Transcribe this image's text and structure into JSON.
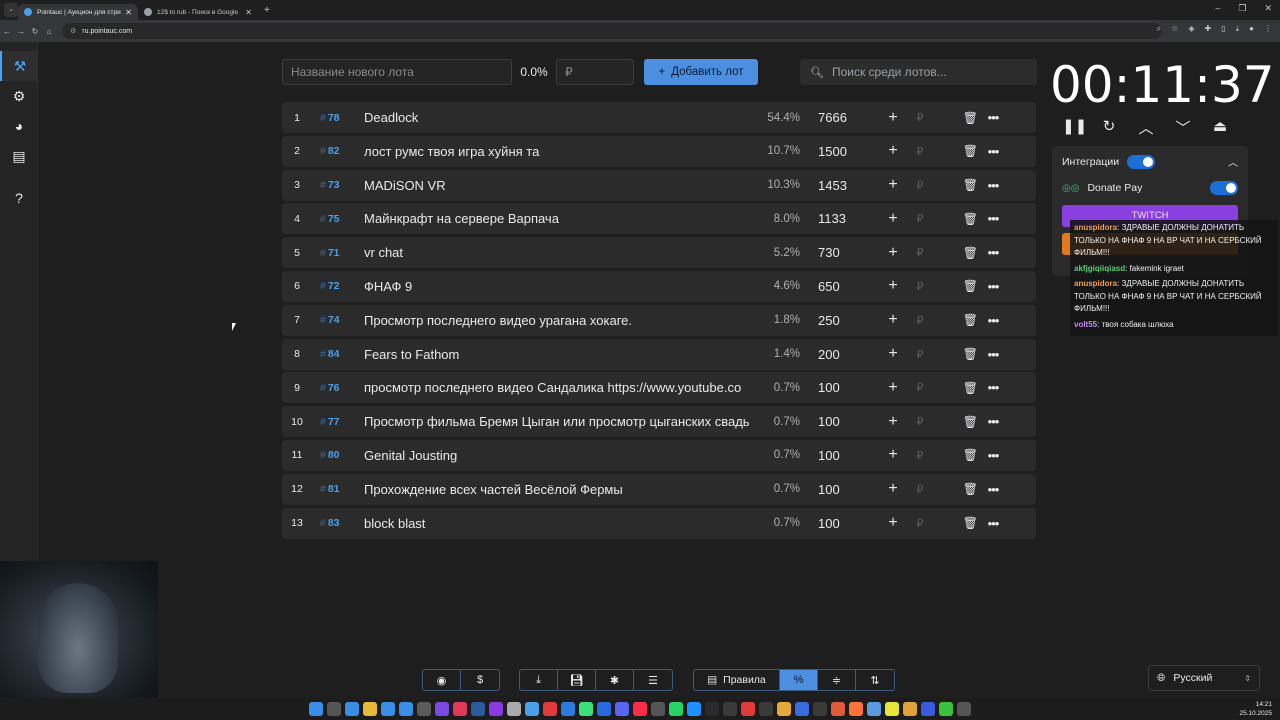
{
  "browser": {
    "tabs": [
      {
        "title": "Pointauc | Аукцион для стриме",
        "active": true,
        "favicon_color": "#4a9fe8"
      },
      {
        "title": "12$ to rub - Поиск в Google",
        "active": false,
        "favicon_color": "#9aa0a6"
      }
    ],
    "url": "ru.pointauc.com"
  },
  "form": {
    "name_placeholder": "Название нового лота",
    "percent": "0.0%",
    "amount_placeholder": "₽",
    "add_label": "Добавить лот",
    "search_placeholder": "Поиск среди лотов..."
  },
  "lots": [
    {
      "num": "1",
      "id": "78",
      "name": "Deadlock",
      "pct": "54.4%",
      "amount": "7666"
    },
    {
      "num": "2",
      "id": "82",
      "name": "лост румс твоя игра хуйня та",
      "pct": "10.7%",
      "amount": "1500"
    },
    {
      "num": "3",
      "id": "73",
      "name": "MADiSON VR",
      "pct": "10.3%",
      "amount": "1453"
    },
    {
      "num": "4",
      "id": "75",
      "name": "Майнкрафт на сервере Варпача",
      "pct": "8.0%",
      "amount": "1133"
    },
    {
      "num": "5",
      "id": "71",
      "name": "vr chat",
      "pct": "5.2%",
      "amount": "730"
    },
    {
      "num": "6",
      "id": "72",
      "name": "ФНАФ 9",
      "pct": "4.6%",
      "amount": "650"
    },
    {
      "num": "7",
      "id": "74",
      "name": "Просмотр последнего видео урагана хокаге.",
      "pct": "1.8%",
      "amount": "250"
    },
    {
      "num": "8",
      "id": "84",
      "name": "Fears to Fathom",
      "pct": "1.4%",
      "amount": "200"
    },
    {
      "num": "9",
      "id": "76",
      "name": "просмотр последнего видео Сандалика https://www.youtube.co",
      "pct": "0.7%",
      "amount": "100"
    },
    {
      "num": "10",
      "id": "77",
      "name": "Просмотр фильма Бремя Цыган или просмотр цыганских свадь",
      "pct": "0.7%",
      "amount": "100"
    },
    {
      "num": "11",
      "id": "80",
      "name": "Genital Jousting",
      "pct": "0.7%",
      "amount": "100"
    },
    {
      "num": "12",
      "id": "81",
      "name": "Прохождение всех частей Весёлой Фермы",
      "pct": "0.7%",
      "amount": "100"
    },
    {
      "num": "13",
      "id": "83",
      "name": "block blast",
      "pct": "0.7%",
      "amount": "100"
    }
  ],
  "timer": {
    "value": "00:11:37"
  },
  "integrations": {
    "title": "Интеграции",
    "donate_pay": "Donate Pay",
    "twitch": "TWITCH"
  },
  "chat": [
    {
      "user": "anuspidora",
      "color": "#f0a050",
      "text": "ЗДРАВЫЕ ДОЛЖНЫ ДОНАТИТЬ ТОЛЬКО НА ФНАФ 9 НА ВР ЧАТ И НА СЕРБСКИЙ ФИЛЬМ!!!"
    },
    {
      "user": "akfjgiqiiqiasd",
      "color": "#5ad07a",
      "text": "fakemink igraet"
    },
    {
      "user": "anuspidora",
      "color": "#f0a050",
      "text": "ЗДРАВЫЕ ДОЛЖНЫ ДОНАТИТЬ ТОЛЬКО НА ФНАФ 9 НА ВР ЧАТ И НА СЕРБСКИЙ ФИЛЬМ!!!"
    },
    {
      "user": "volt55",
      "color": "#c08cf0",
      "text": "твоя собака шлюха"
    }
  ],
  "bottom": {
    "rules_label": "Правила"
  },
  "language": "Русский",
  "clock": {
    "time": "14:21",
    "date": "25.10.2025"
  }
}
